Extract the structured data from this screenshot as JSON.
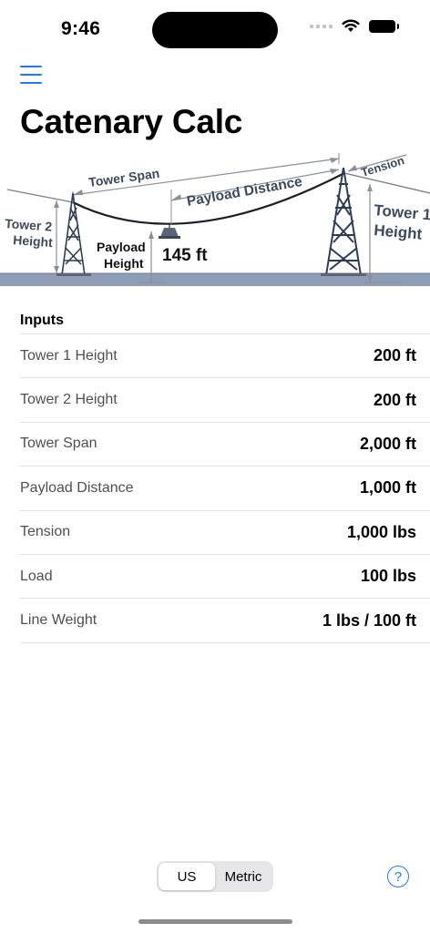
{
  "status_bar": {
    "time": "9:46"
  },
  "app": {
    "title": "Catenary Calc"
  },
  "diagram": {
    "labels": {
      "tower_span": "Tower Span",
      "payload_distance": "Payload Distance",
      "tension": "Tension",
      "tower2_height_line1": "Tower 2",
      "tower2_height_line2": "Height",
      "tower1_height_line1": "Tower 1",
      "tower1_height_line2": "Height",
      "payload_height_line1": "Payload",
      "payload_height_line2": "Height",
      "payload_height_value": "145 ft"
    }
  },
  "inputs": {
    "header": "Inputs",
    "rows": [
      {
        "label": "Tower 1 Height",
        "value": "200 ft"
      },
      {
        "label": "Tower 2 Height",
        "value": "200 ft"
      },
      {
        "label": "Tower Span",
        "value": "2,000 ft"
      },
      {
        "label": "Payload Distance",
        "value": "1,000 ft"
      },
      {
        "label": "Tension",
        "value": "1,000 lbs"
      },
      {
        "label": "Load",
        "value": "100 lbs"
      },
      {
        "label": "Line Weight",
        "value": "1 lbs / 100 ft"
      }
    ]
  },
  "units": {
    "options": [
      "US",
      "Metric"
    ],
    "selected": "US"
  },
  "help": {
    "symbol": "?"
  },
  "colors": {
    "accent": "#1a7cf5",
    "ground": "#8e9cb6",
    "diagram_text": "#3d4a5c"
  }
}
